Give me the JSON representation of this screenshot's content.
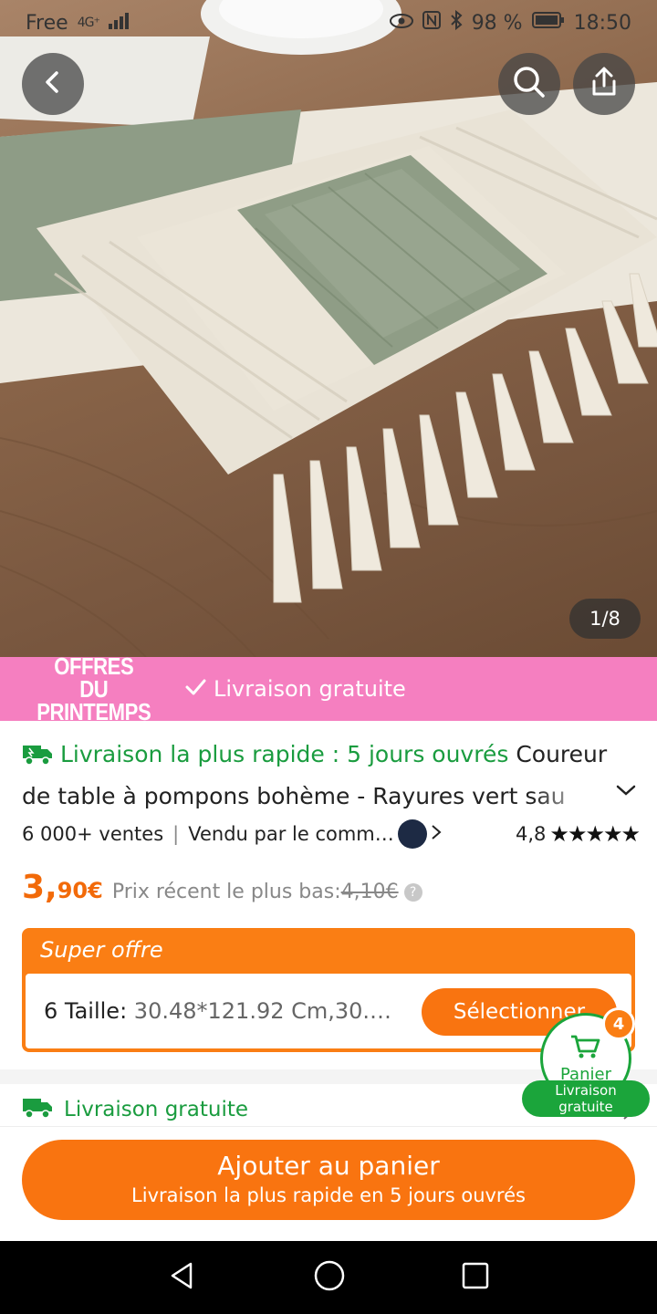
{
  "status": {
    "carrier": "Free",
    "network": "4G⁺",
    "battery": "98 %",
    "time": "18:50"
  },
  "gallery": {
    "counter": "1/8"
  },
  "banner": {
    "line1": "OFFRES",
    "line2": "DU PRINTEMPS",
    "free_shipping": "Livraison gratuite"
  },
  "product": {
    "fast_delivery": "Livraison la plus rapide : 5 jours ouvrés",
    "title_part1": "Coureur",
    "title_part2": "de table à pompons bohème - Rayures vert sau",
    "sales": "6 000+ ventes",
    "seller": "Vendu par le comm…",
    "rating": "4,8",
    "stars": "★★★★★",
    "price_main": "3,",
    "price_cents": "90€",
    "recent_label": "Prix récent le plus bas:",
    "recent_price": "4,10€"
  },
  "offer": {
    "label": "Super offre",
    "size_label": "6 Taille:",
    "size_value": "30.48*121.92 Cm,30.…",
    "select_button": "Sélectionner"
  },
  "cart": {
    "badge": "4",
    "label": "Panier",
    "pill_line1": "Livraison",
    "pill_line2": "gratuite"
  },
  "shipping": {
    "label": "Livraison gratuite"
  },
  "add_to_cart": {
    "title": "Ajouter au panier",
    "subtitle": "Livraison la plus rapide en 5 jours ouvrés"
  },
  "colors": {
    "accent_orange": "#f97410",
    "green": "#1a9c3f",
    "banner_pink": "#f57fc0"
  }
}
